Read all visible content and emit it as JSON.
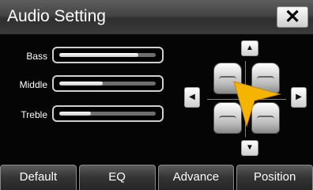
{
  "header": {
    "title": "Audio Setting",
    "close_label": "✕"
  },
  "sliders": [
    {
      "label": "Bass",
      "level": 0.82
    },
    {
      "label": "Middle",
      "level": 0.45
    },
    {
      "label": "Treble",
      "level": 0.33
    }
  ],
  "balance": {
    "up_icon": "▲",
    "down_icon": "▼",
    "left_icon": "◀",
    "right_icon": "▶",
    "pointer_color": "#f5b400"
  },
  "tabs": [
    {
      "label": "Default"
    },
    {
      "label": "EQ"
    },
    {
      "label": "Advance"
    },
    {
      "label": "Position"
    }
  ]
}
